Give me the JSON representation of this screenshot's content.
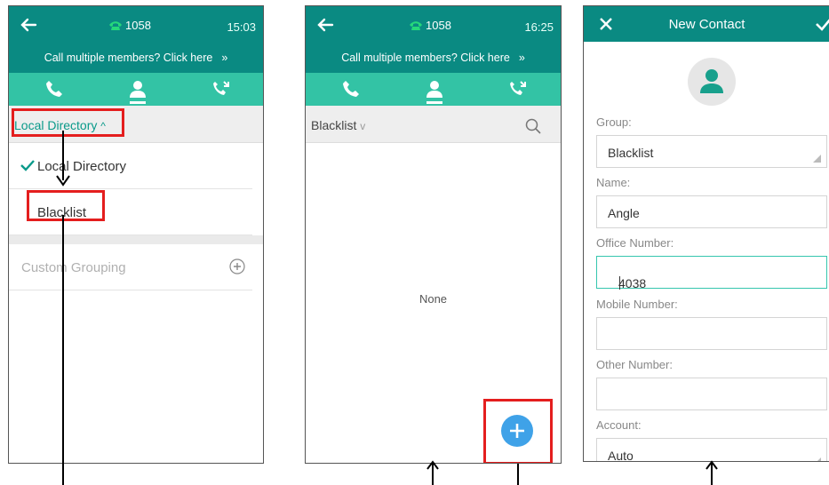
{
  "panel1": {
    "call_ext": "1058",
    "time": "15:03",
    "banner": "Call multiple members? Click here",
    "banner_chevron": "»",
    "dropdown_label": "Local Directory",
    "dropdown_caret": "^",
    "groups": [
      "Local Directory",
      "Blacklist"
    ],
    "custom_grouping": "Custom Grouping"
  },
  "panel2": {
    "call_ext": "1058",
    "time": "16:25",
    "banner": "Call multiple members? Click here",
    "banner_chevron": "»",
    "dropdown_label": "Blacklist",
    "dropdown_caret": "v",
    "empty_text": "None"
  },
  "panel3": {
    "title": "New Contact",
    "group_label": "Group:",
    "group_value": "Blacklist",
    "name_label": "Name:",
    "name_value": "Angle",
    "office_label": "Office Number:",
    "office_value": "4038",
    "mobile_label": "Mobile Number:",
    "mobile_value": "",
    "other_label": "Other Number:",
    "other_value": "",
    "account_label": "Account:",
    "account_value": "Auto"
  },
  "colors": {
    "header_teal": "#0a8a82",
    "tab_teal": "#33c3a5",
    "highlight_red": "#e41e1e",
    "fab_blue": "#3fa2e8",
    "call_green": "#25d97a"
  },
  "icons": [
    "back-arrow-icon",
    "phone-icon",
    "handset-icon",
    "contact-icon",
    "call-history-icon",
    "check-icon",
    "plus-circle-icon",
    "search-icon",
    "plus-icon",
    "close-icon",
    "checkmark-icon",
    "avatar-icon"
  ]
}
